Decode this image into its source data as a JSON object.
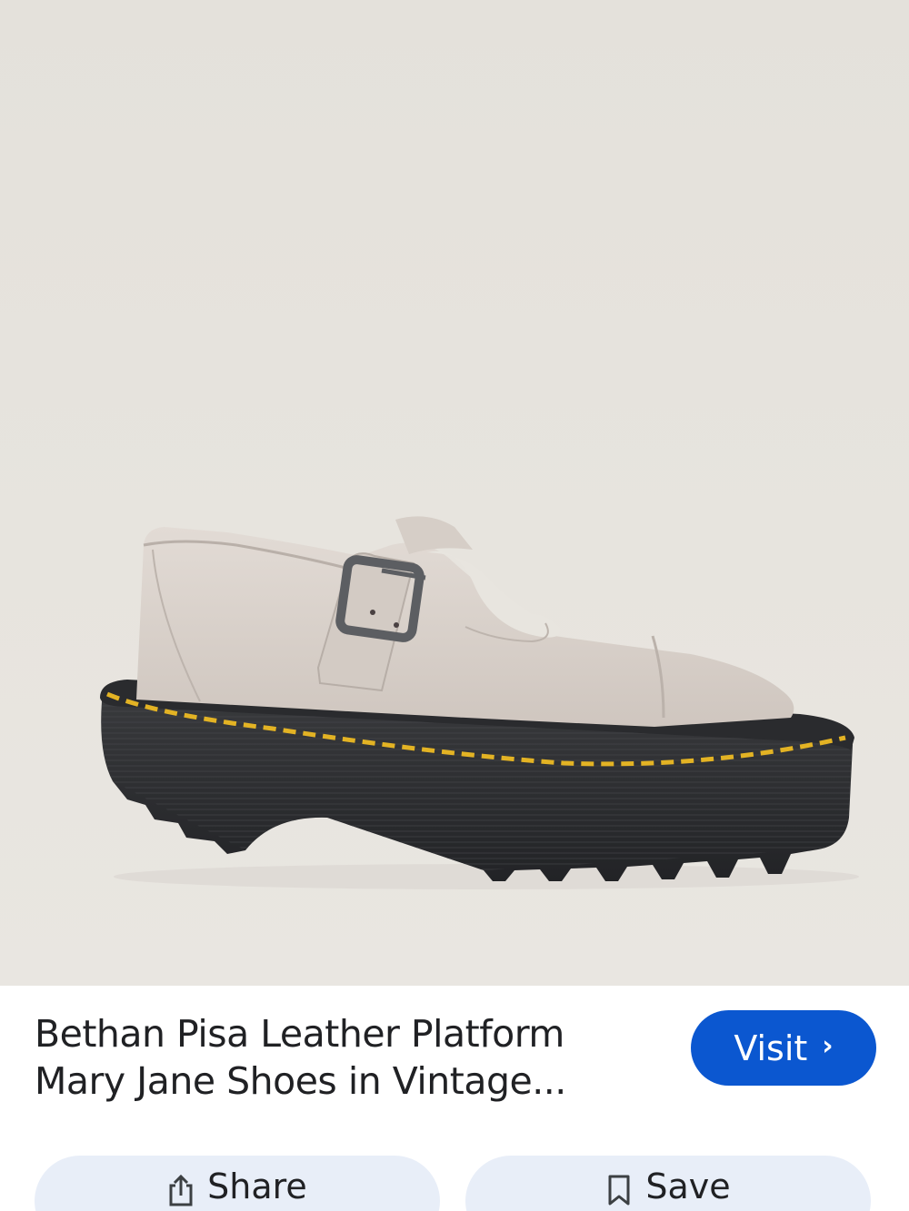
{
  "product": {
    "title_line1": "Bethan Pisa Leather Platform",
    "title_line2": "Mary Jane Shoes in Vintage..."
  },
  "actions": {
    "visit_label": "Visit",
    "share_label": "Share",
    "save_label": "Save"
  },
  "icons": {
    "visit": "chevron-right-icon",
    "share": "share-icon",
    "save": "bookmark-icon"
  },
  "colors": {
    "visit_button": "#0b57d0",
    "action_button_bg": "#e8eef8",
    "photo_background": "#e6e3dd",
    "shoe_leather": "#d9d1cb",
    "sole": "#2f3033",
    "stitching": "#e3b324"
  }
}
